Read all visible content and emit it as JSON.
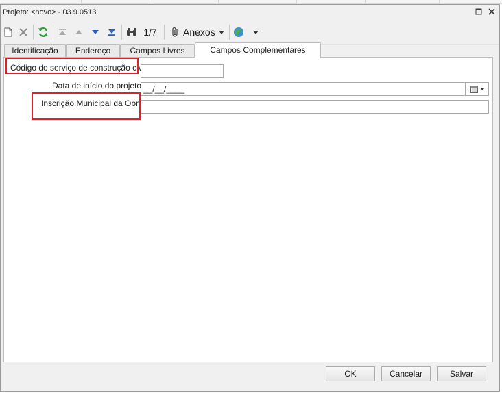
{
  "window": {
    "title": "Projeto: <novo> - 03.9.0513"
  },
  "toolbar": {
    "record_counter": "1/7",
    "attachments_label": "Anexos"
  },
  "tabs": [
    {
      "label": "Identificação"
    },
    {
      "label": "Endereço"
    },
    {
      "label": "Campos Livres"
    },
    {
      "label": "Campos Complementares"
    }
  ],
  "form": {
    "service_code": {
      "label": "Código do serviço de construção civil:",
      "value": ""
    },
    "start_date": {
      "label": "Data de início do projeto:",
      "value": "__/__/____"
    },
    "municipal_registration": {
      "label": "Inscrição Municipal da Obra:",
      "value": ""
    }
  },
  "buttons": {
    "ok": "OK",
    "cancel": "Cancelar",
    "save": "Salvar"
  },
  "colors": {
    "highlight": "#e11f26",
    "accent_green": "#2e9b3a",
    "accent_blue": "#2a62c4"
  }
}
